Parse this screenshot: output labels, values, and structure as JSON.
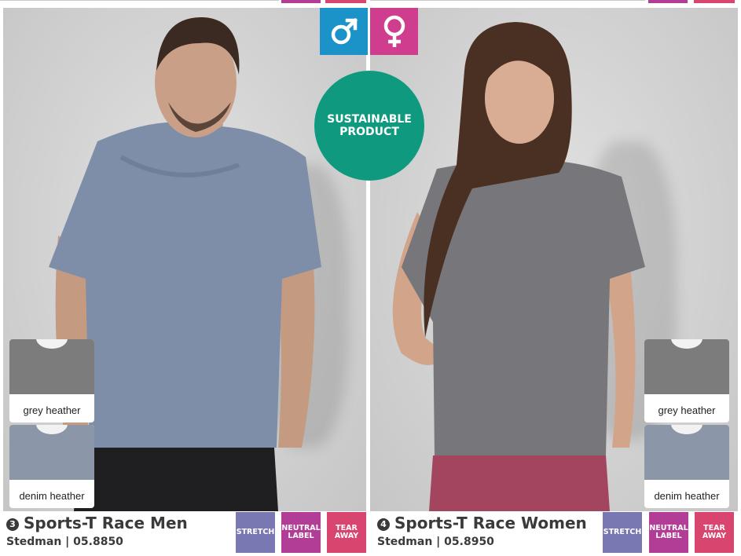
{
  "colors": {
    "male_icon": "#1c93c8",
    "female_icon": "#cf3d8f",
    "sustainable": "#0f9a80",
    "stretch": "#7a78b2",
    "neutral_label": "#b23d96",
    "tear_away": "#d8466f"
  },
  "gender_icons": {
    "male": "male-symbol-icon",
    "female": "female-symbol-icon"
  },
  "sustainable": {
    "line1": "SUSTAINABLE",
    "line2": "PRODUCT"
  },
  "men": {
    "number": "3",
    "title": "Sports-T Race Men",
    "subtitle": "Stedman | 05.8850",
    "swatches": [
      {
        "label": "grey heather",
        "color": "#7c7c7c"
      },
      {
        "label": "denim heather",
        "color": "#8b97a9"
      }
    ],
    "badges": {
      "stretch": "STRETCH",
      "neutral_1": "NEUTRAL",
      "neutral_2": "LABEL",
      "tear_1": "TEAR",
      "tear_2": "AWAY"
    }
  },
  "women": {
    "number": "4",
    "title": "Sports-T Race Women",
    "subtitle": "Stedman | 05.8950",
    "swatches": [
      {
        "label": "grey heather",
        "color": "#7c7c7c"
      },
      {
        "label": "denim heather",
        "color": "#8b97a9"
      }
    ],
    "badges": {
      "stretch": "STRETCH",
      "neutral_1": "NEUTRAL",
      "neutral_2": "LABEL",
      "tear_1": "TEAR",
      "tear_2": "AWAY"
    }
  }
}
